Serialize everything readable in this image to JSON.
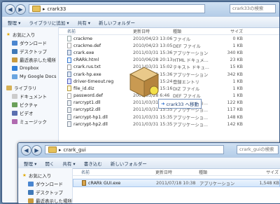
{
  "back_window": {
    "path": [
      "crark33"
    ],
    "search_placeholder": "crark33の検索",
    "toolbar": [
      "整理 ▾",
      "ライブラリに追加 ▾",
      "共有 ▾",
      "新しいフォルダー"
    ],
    "nav": {
      "favorites": "お気に入り",
      "fav_items": [
        "ダウンロード",
        "デスクトップ",
        "最近表示した場所",
        "Dropbox",
        "My Google Docs"
      ],
      "libraries": "ライブラリ",
      "lib_items": [
        "ドキュメント",
        "ピクチャ",
        "ビデオ",
        "ミュージック"
      ]
    },
    "columns": [
      "名前",
      "更新日時",
      "種類",
      "サイズ"
    ],
    "files": [
      {
        "name": "crackme",
        "date": "2010/04/23 13:06",
        "type": "ファイル",
        "size": "0 KB",
        "icon": "file"
      },
      {
        "name": "crackme.def",
        "date": "2010/04/23 13:05",
        "type": "DEF ファイル",
        "size": "1 KB",
        "icon": "def"
      },
      {
        "name": "crark.exe",
        "date": "2011/03/31 15:36",
        "type": "アプリケーション",
        "size": "340 KB",
        "icon": "exe"
      },
      {
        "name": "cRARk.html",
        "date": "2010/06/28 20:13",
        "type": "HTML ドキュメ...",
        "size": "23 KB",
        "icon": "htm"
      },
      {
        "name": "crark.rus.txt",
        "date": "2011/03/31 15:02",
        "type": "テキスト ドキュ...",
        "size": "15 KB",
        "icon": "txt"
      },
      {
        "name": "crark-hp.exe",
        "date": "2011/03/31 15:36",
        "type": "アプリケーション",
        "size": "342 KB",
        "icon": "exe"
      },
      {
        "name": "driver-timeout.reg",
        "date": "2009/09/13 15:24",
        "type": "登録エントリ",
        "size": "1 KB",
        "icon": "reg"
      },
      {
        "name": "file_id.diz",
        "date": "2011/03/31 15:16",
        "type": "DIZ ファイル",
        "size": "1 KB",
        "icon": "diz"
      },
      {
        "name": "password.def",
        "date": "2001/03/28 6:46",
        "type": "DEF ファイル",
        "size": "1 KB",
        "icon": "def"
      },
      {
        "name": "rarcrypt1.dll",
        "date": "2011/03/31 15:35",
        "type": "アプリケーショ...",
        "size": "122 KB",
        "icon": "dll"
      },
      {
        "name": "rarcrypt2.dll",
        "date": "2011/03/31 15:35",
        "type": "アプリケーショ...",
        "size": "117 KB",
        "icon": "dll"
      },
      {
        "name": "rarcrypt-hp1.dll",
        "date": "2011/03/31 15:35",
        "type": "アプリケーショ...",
        "size": "148 KB",
        "icon": "dll"
      },
      {
        "name": "rarcrypt-hp2.dll",
        "date": "2011/03/31 15:35",
        "type": "アプリケーショ...",
        "size": "142 KB",
        "icon": "dll"
      }
    ],
    "drag_tooltip": "crark33 へ移動"
  },
  "front_window": {
    "path": [
      "crark_gui"
    ],
    "search_placeholder": "crark_guiの検索",
    "toolbar": [
      "整理 ▾",
      "開く",
      "共有 ▾",
      "書き込む",
      "新しいフォルダー"
    ],
    "nav": {
      "favorites": "お気に入り",
      "fav_items": [
        "ダウンロード",
        "デスクトップ",
        "最近表示した場所"
      ]
    },
    "columns": [
      "名前",
      "更新日時",
      "種類",
      "サイズ"
    ],
    "files": [
      {
        "name": "cRARk GUI.exe",
        "date": "2011/07/18 10:38",
        "type": "アプリケーション",
        "size": "1,548 KB",
        "icon": "gold"
      }
    ]
  },
  "colors": {
    "accent": "#3a5a86",
    "folder": "#e7c25b",
    "selection": "#d5e7fb"
  }
}
